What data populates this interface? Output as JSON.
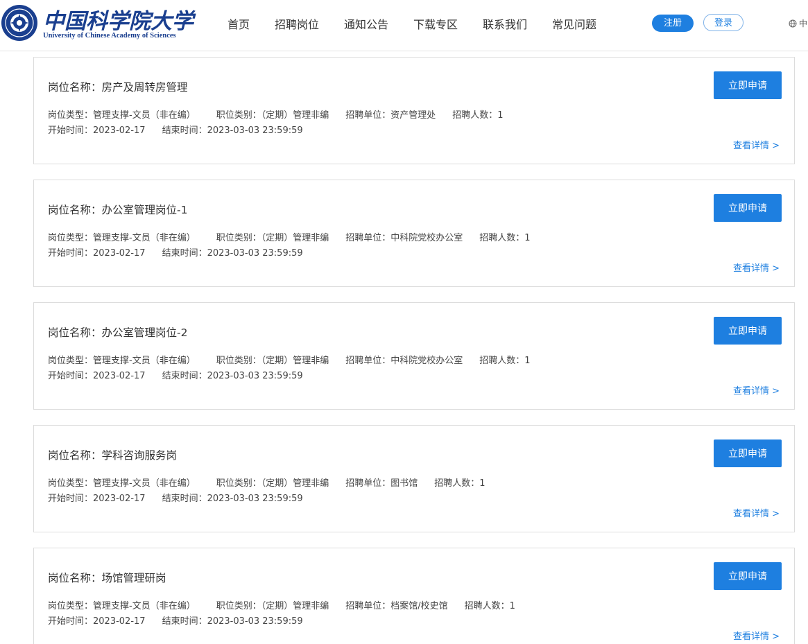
{
  "header": {
    "logo_cn": "中国科学院大学",
    "logo_en": "University of  Chinese Academy of Sciences",
    "nav": [
      "首页",
      "招聘岗位",
      "通知公告",
      "下载专区",
      "联系我们",
      "常见问题"
    ],
    "register_label": "注册",
    "login_label": "登录",
    "lang_label": "中"
  },
  "jobs": [
    {
      "title": "岗位名称：房产及周转房管理",
      "type": "岗位类型：管理支撑-文员（非在编）",
      "category": "职位类别：（定期）管理非编",
      "unit": "招聘单位：资产管理处",
      "count": "招聘人数：1",
      "start": "开始时间：2023-02-17",
      "end": "结束时间：2023-03-03 23:59:59",
      "apply_label": "立即申请",
      "detail_label": "查看详情 >"
    },
    {
      "title": "岗位名称：办公室管理岗位-1",
      "type": "岗位类型：管理支撑-文员（非在编）",
      "category": "职位类别：（定期）管理非编",
      "unit": "招聘单位：中科院党校办公室",
      "count": "招聘人数：1",
      "start": "开始时间：2023-02-17",
      "end": "结束时间：2023-03-03 23:59:59",
      "apply_label": "立即申请",
      "detail_label": "查看详情 >"
    },
    {
      "title": "岗位名称：办公室管理岗位-2",
      "type": "岗位类型：管理支撑-文员（非在编）",
      "category": "职位类别：（定期）管理非编",
      "unit": "招聘单位：中科院党校办公室",
      "count": "招聘人数：1",
      "start": "开始时间：2023-02-17",
      "end": "结束时间：2023-03-03 23:59:59",
      "apply_label": "立即申请",
      "detail_label": "查看详情 >"
    },
    {
      "title": "岗位名称：学科咨询服务岗",
      "type": "岗位类型：管理支撑-文员（非在编）",
      "category": "职位类别：（定期）管理非编",
      "unit": "招聘单位：图书馆",
      "count": "招聘人数：1",
      "start": "开始时间：2023-02-17",
      "end": "结束时间：2023-03-03 23:59:59",
      "apply_label": "立即申请",
      "detail_label": "查看详情 >"
    },
    {
      "title": "岗位名称：场馆管理研岗",
      "type": "岗位类型：管理支撑-文员（非在编）",
      "category": "职位类别：（定期）管理非编",
      "unit": "招聘单位：档案馆/校史馆",
      "count": "招聘人数：1",
      "start": "开始时间：2023-02-17",
      "end": "结束时间：2023-03-03 23:59:59",
      "apply_label": "立即申请",
      "detail_label": "查看详情 >"
    }
  ],
  "icons": {
    "logo": "ucas-emblem-icon",
    "lang": "globe-icon"
  },
  "colors": {
    "accent": "#1e7fe0",
    "brand": "#1a3f8f"
  }
}
